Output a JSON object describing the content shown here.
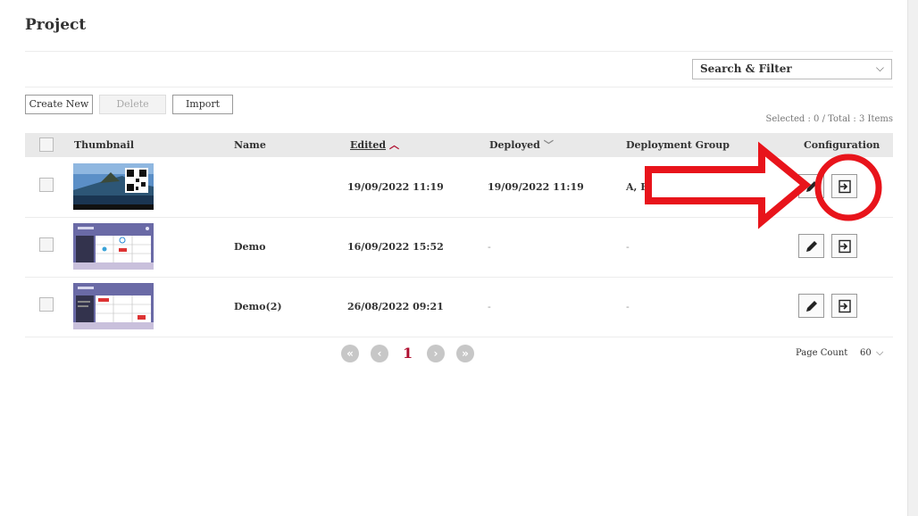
{
  "page": {
    "title": "Project"
  },
  "search_filter": {
    "label": "Search & Filter"
  },
  "toolbar": {
    "create_new": "Create New",
    "delete": "Delete",
    "import": "Import"
  },
  "summary": {
    "text": "Selected : 0 / Total : 3 Items"
  },
  "table": {
    "columns": {
      "thumbnail": "Thumbnail",
      "name": "Name",
      "edited": "Edited",
      "deployed": "Deployed",
      "deployment_group": "Deployment Group",
      "configuration": "Configuration"
    },
    "rows": [
      {
        "name": "",
        "edited": "19/09/2022 11:19",
        "deployed": "19/09/2022 11:19",
        "deployment_group": "A, B, C"
      },
      {
        "name": "Demo",
        "edited": "16/09/2022 15:52",
        "deployed": "-",
        "deployment_group": "-"
      },
      {
        "name": "Demo(2)",
        "edited": "26/08/2022 09:21",
        "deployed": "-",
        "deployment_group": "-"
      }
    ]
  },
  "pagination": {
    "current_page": "1",
    "page_count_label": "Page Count",
    "page_count_value": "60"
  },
  "annotation": {
    "color": "#e8141b"
  },
  "colors": {
    "accent": "#b01030",
    "header_bg": "#e9e9e9"
  }
}
